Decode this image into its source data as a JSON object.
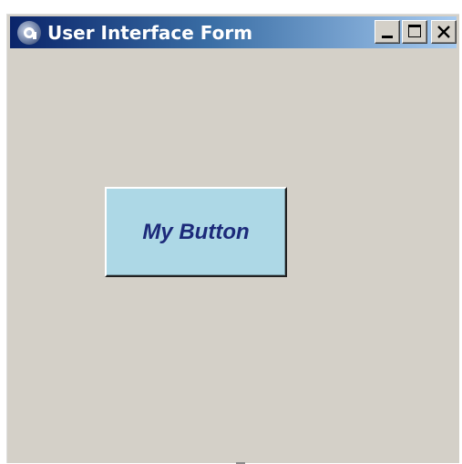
{
  "window": {
    "title": "User Interface Form",
    "background_color": "#d4d0c8",
    "icon": "app-logo-icon",
    "controls": {
      "minimize_icon": "minimize-icon",
      "maximize_icon": "maximize-icon",
      "close_icon": "close-icon"
    }
  },
  "form": {
    "button": {
      "label": "My Button",
      "background_color": "#add8e6",
      "text_color": "#1c2a7a"
    }
  }
}
